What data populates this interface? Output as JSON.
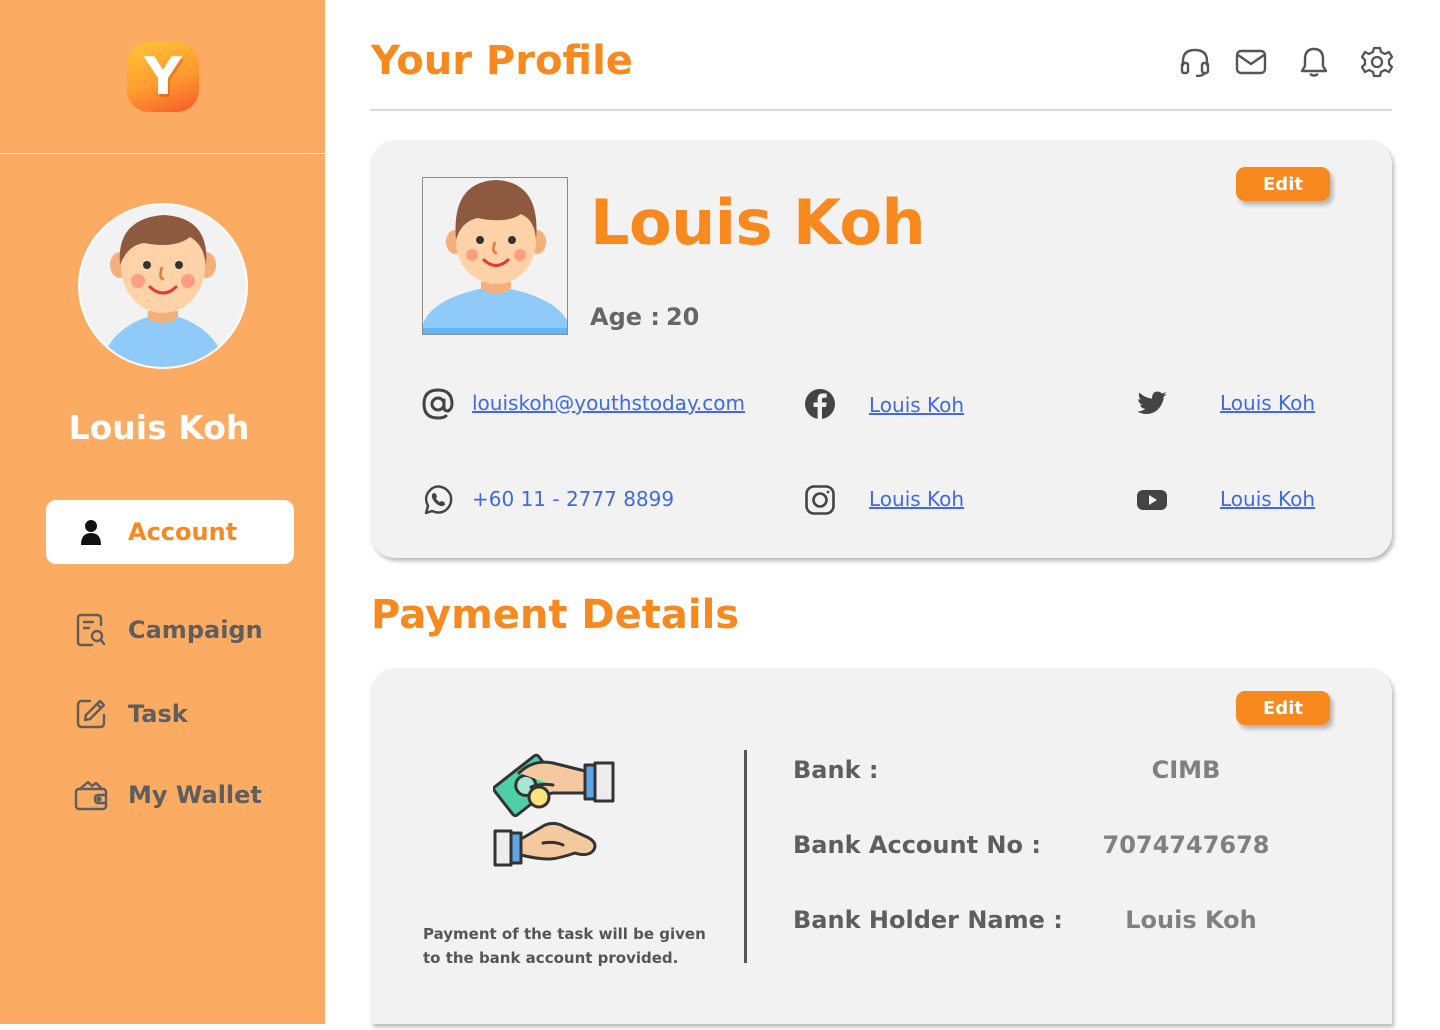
{
  "app": {
    "logo_letter": "Y"
  },
  "sidebar": {
    "user_name": "Louis Koh",
    "items": [
      {
        "label": "Account",
        "icon": "person-icon",
        "active": true
      },
      {
        "label": "Campaign",
        "icon": "campaign-search-icon",
        "active": false
      },
      {
        "label": "Task",
        "icon": "edit-square-icon",
        "active": false
      },
      {
        "label": "My Wallet",
        "icon": "wallet-icon",
        "active": false
      }
    ]
  },
  "header": {
    "title": "Your Profile",
    "icons": [
      "headset-icon",
      "mail-icon",
      "bell-icon",
      "gear-icon"
    ]
  },
  "profile": {
    "name": "Louis Koh",
    "age_label": "Age :",
    "age_value": "20",
    "edit_label": "Edit",
    "contacts": {
      "email": "louiskoh@youthstoday.com",
      "phone": "+60 11 - 2777 8899",
      "facebook": "Louis Koh",
      "instagram": "Louis Koh",
      "twitter": "Louis Koh",
      "youtube": "Louis Koh"
    }
  },
  "payment": {
    "title": "Payment Details",
    "edit_label": "Edit",
    "note": "Payment of the task will be given to the bank account provided.",
    "fields": [
      {
        "label": "Bank :",
        "value": "CIMB"
      },
      {
        "label": "Bank Account No :",
        "value": "7074747678"
      },
      {
        "label": "Bank Holder Name :",
        "value": "Louis Koh"
      }
    ]
  },
  "colors": {
    "accent": "#F7891F",
    "sidebar_bg": "#FCAB62",
    "card_bg": "#F2F2F2",
    "link": "#4169E1"
  }
}
